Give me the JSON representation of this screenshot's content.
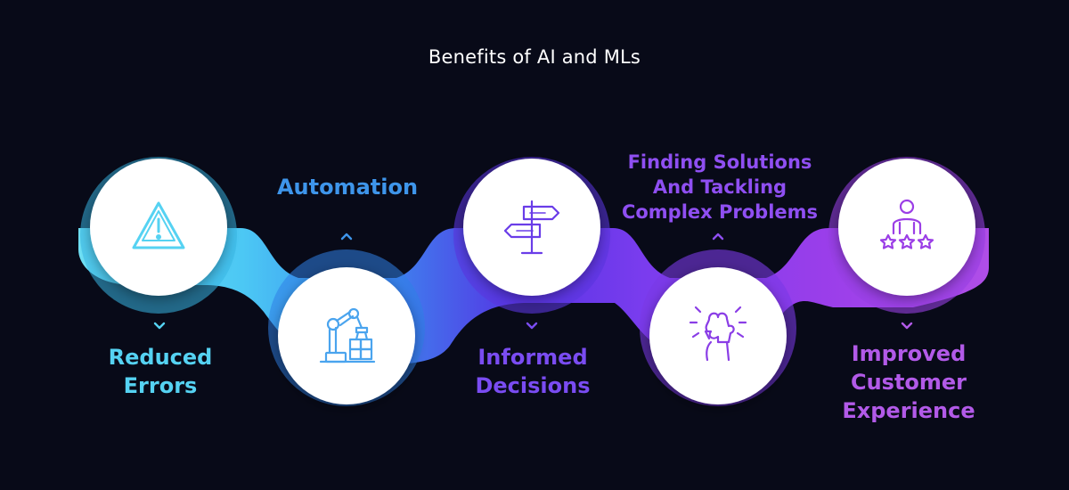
{
  "title": "Benefits of AI and MLs",
  "colors": {
    "background": "#080a18",
    "cyan": "#4dd6f0",
    "blue": "#3b8ff0",
    "violet": "#6a3de8",
    "purple": "#8a3df0",
    "magenta": "#b048e8"
  },
  "steps": [
    {
      "icon": "warning-icon",
      "label_lines": [
        "Reduced",
        "Errors"
      ],
      "color": "#55d2f2"
    },
    {
      "icon": "robotic-arm-icon",
      "label_lines": [
        "Automation"
      ],
      "color": "#3e95ea"
    },
    {
      "icon": "signpost-icon",
      "label_lines": [
        "Informed",
        "Decisions"
      ],
      "color": "#7a4cf2"
    },
    {
      "icon": "puzzle-hand-icon",
      "label_lines": [
        "Finding Solutions",
        "And Tackling",
        "Complex Problems"
      ],
      "color": "#8f4ff2"
    },
    {
      "icon": "customer-rating-icon",
      "label_lines": [
        "Improved",
        "Customer",
        "Experience"
      ],
      "color": "#b25ae8"
    }
  ]
}
